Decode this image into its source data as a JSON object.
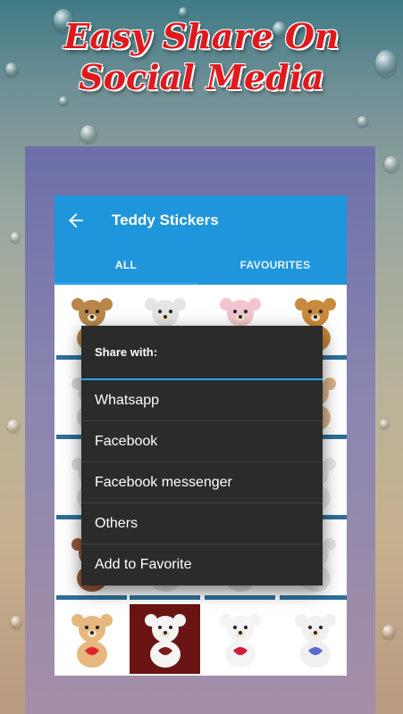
{
  "promo": {
    "headline_line1": "Easy Share On",
    "headline_line2": "Social Media"
  },
  "app": {
    "title": "Teddy Stickers",
    "back_icon": "arrow-left-icon"
  },
  "tabs": [
    {
      "label": "ALL",
      "selected": true
    },
    {
      "label": "FAVOURITES",
      "selected": false
    }
  ],
  "colors": {
    "app_bar": "#1f95dc",
    "indicator": "#29a3ef",
    "dialog": "#2b2b2b",
    "headline": "#e0191d"
  },
  "share_dialog": {
    "title": "Share with:",
    "options": [
      {
        "label": "Whatsapp"
      },
      {
        "label": "Facebook"
      },
      {
        "label": "Facebook messenger"
      },
      {
        "label": "Others"
      },
      {
        "label": "Add to Favorite"
      }
    ]
  },
  "stickers": [
    {
      "name": "teddy-bear-sticker",
      "bear": "#b9874a",
      "accent": "#d43b2f"
    },
    {
      "name": "teddy-bear-sticker",
      "bear": "#e4e4e4",
      "accent": "#c94646"
    },
    {
      "name": "teddy-bear-sticker",
      "bear": "#f2c6cf",
      "accent": "#8a5a3c"
    },
    {
      "name": "teddy-bear-sticker",
      "bear": "#c98a3d",
      "accent": "#b32a2a"
    },
    {
      "name": "teddy-bear-sticker",
      "bear": "#d9d9d9",
      "accent": "#aaaaaa"
    },
    {
      "name": "teddy-bear-sticker",
      "bear": "#cfcfcf",
      "accent": "#cc3333"
    },
    {
      "name": "teddy-bear-sticker",
      "bear": "#cfcfcf",
      "accent": "#cc3333"
    },
    {
      "name": "teddy-bear-sticker",
      "bear": "#d9b48a",
      "accent": "#8b2b2b"
    },
    {
      "name": "teddy-bear-sticker",
      "bear": "#e0e0e0",
      "accent": "#cc2222"
    },
    {
      "name": "teddy-bear-sticker",
      "bear": "#e0e0e0",
      "accent": "#cc2222"
    },
    {
      "name": "teddy-bear-sticker",
      "bear": "#e0e0e0",
      "accent": "#cc2222"
    },
    {
      "name": "teddy-bear-sticker",
      "bear": "#e8e8e8",
      "accent": "#cc2222"
    },
    {
      "name": "teddy-bear-sticker",
      "bear": "#9a5a3a",
      "accent": "#d02020"
    },
    {
      "name": "teddy-bear-sticker",
      "bear": "#e0e0e0",
      "accent": "#cc2222"
    },
    {
      "name": "teddy-bear-sticker",
      "bear": "#e0e0e0",
      "accent": "#cc2222"
    },
    {
      "name": "teddy-bear-sticker",
      "bear": "#e8e8e8",
      "accent": "#cc2222"
    },
    {
      "name": "teddy-bear-sticker",
      "bear": "#e6b77e",
      "accent": "#e0262b"
    },
    {
      "name": "teddy-bear-sticker",
      "bear": "#f4f4f4",
      "accent": "#7a1d1d"
    },
    {
      "name": "teddy-bear-sticker",
      "bear": "#f4f4f4",
      "accent": "#d41c3a"
    },
    {
      "name": "teddy-bear-sticker",
      "bear": "#f0f0f0",
      "accent": "#5b6bd1"
    }
  ]
}
